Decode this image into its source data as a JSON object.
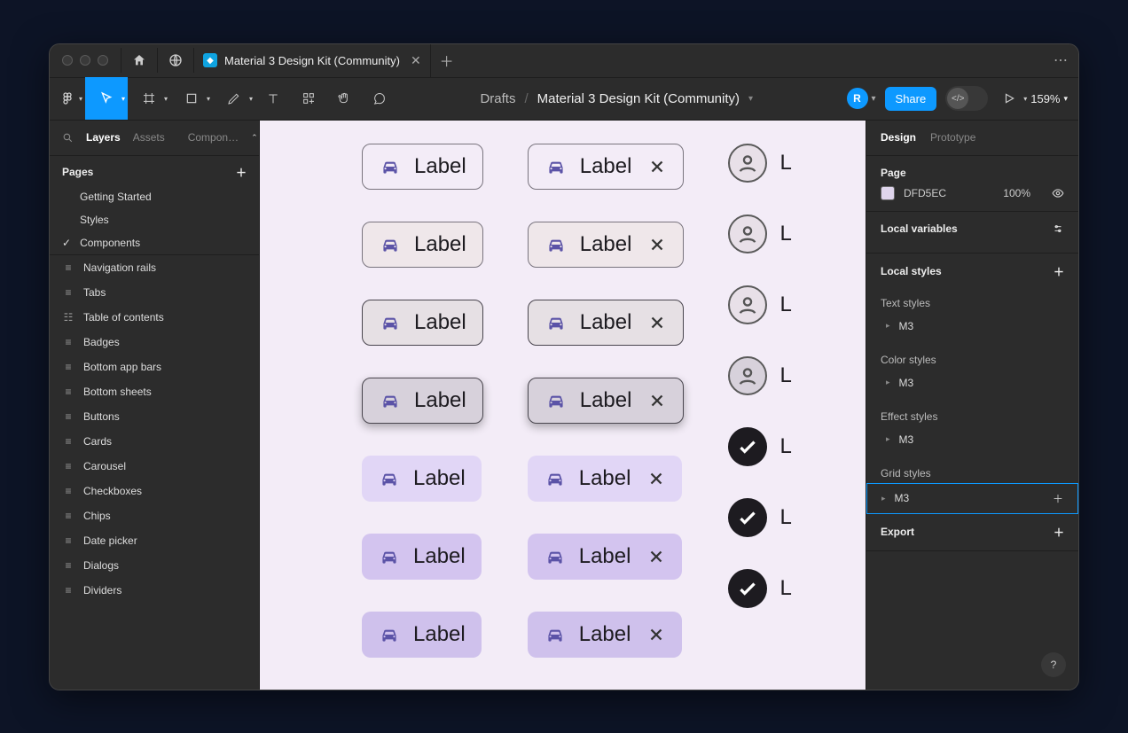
{
  "tab_title": "Material 3 Design Kit (Community)",
  "breadcrumb": {
    "root": "Drafts",
    "file": "Material 3 Design Kit (Community)"
  },
  "toolbar": {
    "avatar_initial": "R",
    "share": "Share",
    "zoom": "159%"
  },
  "left": {
    "tabs": [
      "Layers",
      "Assets",
      "Compon…"
    ],
    "pages_heading": "Pages",
    "pages": [
      "Getting Started",
      "Styles",
      "Components"
    ],
    "layers": [
      "Navigation rails",
      "Tabs",
      "Table of contents",
      "Badges",
      "Bottom app bars",
      "Bottom sheets",
      "Buttons",
      "Cards",
      "Carousel",
      "Checkboxes",
      "Chips",
      "Date picker",
      "Dialogs",
      "Dividers"
    ]
  },
  "canvas": {
    "chip_label": "Label",
    "third_col_label": "L"
  },
  "right": {
    "tabs": [
      "Design",
      "Prototype"
    ],
    "page_heading": "Page",
    "page_color": "DFD5EC",
    "page_opacity": "100%",
    "local_variables": "Local variables",
    "local_styles": "Local styles",
    "text_styles": "Text styles",
    "color_styles": "Color styles",
    "effect_styles": "Effect styles",
    "grid_styles": "Grid styles",
    "style_item": "M3",
    "export": "Export"
  }
}
